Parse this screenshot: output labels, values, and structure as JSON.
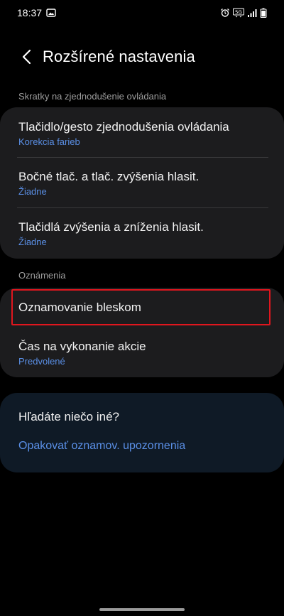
{
  "status_bar": {
    "time": "18:37",
    "icons": [
      "gallery-icon",
      "alarm-icon",
      "5g-icon",
      "signal-icon",
      "battery-icon"
    ],
    "network_label": "5G"
  },
  "header": {
    "title": "Rozšírené nastavenia",
    "back_icon": "chevron-left-icon"
  },
  "sections": [
    {
      "label": "Skratky na zjednodušenie ovládania",
      "items": [
        {
          "title": "Tlačidlo/gesto zjednodušenia ovládania",
          "subtitle": "Korekcia farieb"
        },
        {
          "title": "Bočné tlač. a tlač. zvýšenia hlasit.",
          "subtitle": "Žiadne"
        },
        {
          "title": "Tlačidlá zvýšenia a zníženia hlasit.",
          "subtitle": "Žiadne"
        }
      ]
    },
    {
      "label": "Oznámenia",
      "items": [
        {
          "title": "Oznamovanie bleskom",
          "subtitle": ""
        },
        {
          "title": "Čas na vykonanie akcie",
          "subtitle": "Predvolené"
        }
      ]
    }
  ],
  "search_card": {
    "title": "Hľadáte niečo iné?",
    "link": "Opakovať oznamov. upozornenia"
  },
  "colors": {
    "background": "#000000",
    "card": "#1c1c1e",
    "search_card": "#0f1a26",
    "accent": "#5a8fe6",
    "highlight": "#e0161e"
  }
}
